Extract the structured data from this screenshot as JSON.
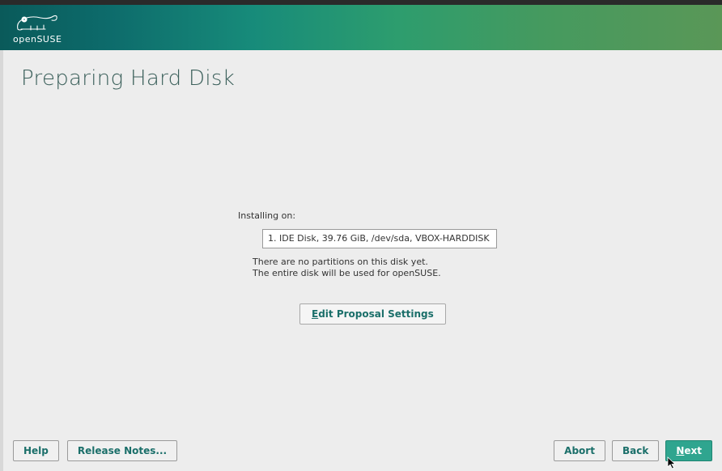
{
  "brand": {
    "name": "openSUSE"
  },
  "page": {
    "title": "Preparing Hard Disk"
  },
  "installing": {
    "label": "Installing on:",
    "selected_disk": "1. IDE Disk, 39.76 GiB, /dev/sda, VBOX-HARDDISK",
    "status_line1": "There are no partitions on this disk yet.",
    "status_line2": "The entire disk will be used for openSUSE."
  },
  "buttons": {
    "edit_proposal_prefix": "E",
    "edit_proposal_rest": "dit Proposal Settings",
    "help_prefix": "H",
    "help_rest": "elp",
    "release_notes": "Release Notes...",
    "abort_prefix": "",
    "abort_mid": "r",
    "abort_before": "Abo",
    "abort_after": "t",
    "back_prefix": "B",
    "back_rest": "ack",
    "next_prefix": "N",
    "next_rest": "ext"
  }
}
